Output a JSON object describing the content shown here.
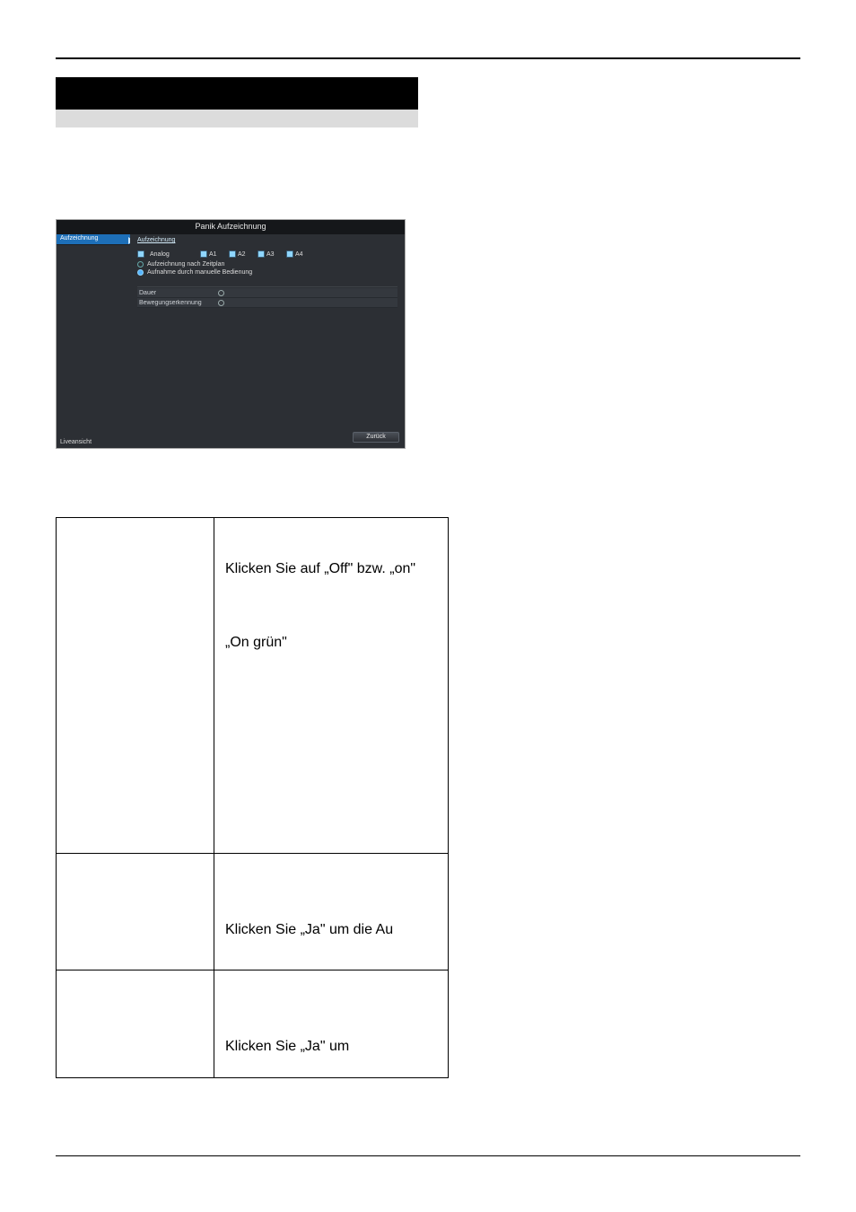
{
  "screenshot": {
    "title": "Panik Aufzeichnung",
    "sidebar": {
      "item0": "Aufzeichnung",
      "bottom": "Liveansicht"
    },
    "tab": "Aufzeichnung",
    "checks": {
      "analog": "Analog",
      "a1": "A1",
      "a2": "A2",
      "a3": "A3",
      "a4": "A4",
      "zeitplan": "Aufzeichnung nach Zeitplan",
      "manuell": "Aufnahme durch manuelle Bedienung"
    },
    "rows": {
      "dauer": "Dauer",
      "bewegung": "Bewegungserkennung"
    },
    "back": "Zurück"
  },
  "table": {
    "r1_a": "Klicken Sie auf „Off\" bzw. „on\"",
    "r1_b": "„On grün\"",
    "r2": "Klicken Sie „Ja\" um die Au",
    "r3": "Klicken Sie „Ja\" um"
  }
}
